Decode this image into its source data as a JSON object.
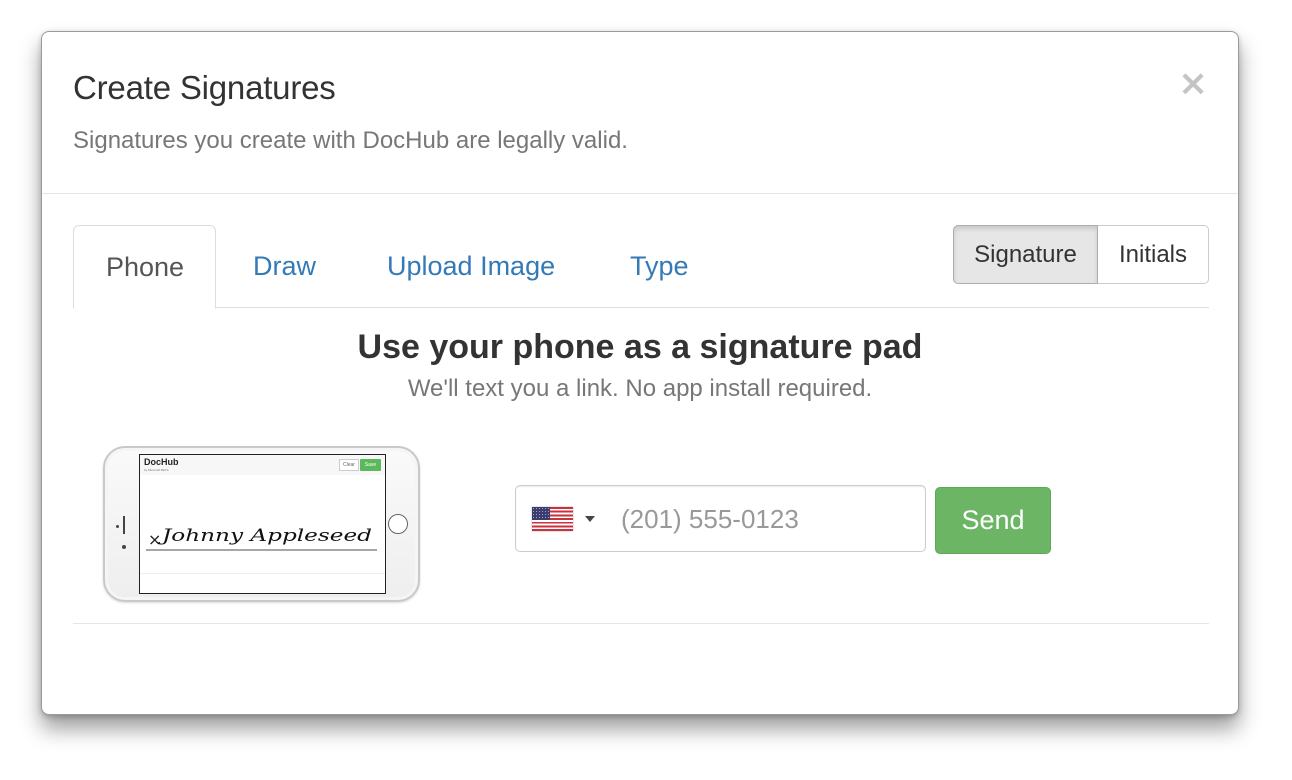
{
  "modal": {
    "title": "Create Signatures",
    "subtitle": "Signatures you create with DocHub are legally valid.",
    "close_icon": "×"
  },
  "tabs": [
    {
      "label": "Phone",
      "active": true
    },
    {
      "label": "Draw",
      "active": false
    },
    {
      "label": "Upload Image",
      "active": false
    },
    {
      "label": "Type",
      "active": false
    }
  ],
  "mode_toggle": {
    "options": [
      {
        "label": "Signature",
        "selected": true
      },
      {
        "label": "Initials",
        "selected": false
      }
    ]
  },
  "phone_panel": {
    "heading": "Use your phone as a signature pad",
    "subheading": "We'll text you a link. No app install required.",
    "illustration": {
      "logo": "DocHub",
      "logo_sub": "by Microsoft    BETA",
      "clear_label": "Clear",
      "save_label": "Save",
      "signature_text": "Johnny Appleseed",
      "sign_mark": "×"
    },
    "country": {
      "selected": "US",
      "flag_icon": "us-flag-icon"
    },
    "phone_input": {
      "value": "",
      "placeholder": "(201) 555-0123"
    },
    "send_label": "Send"
  },
  "colors": {
    "link": "#337ab7",
    "send_button": "#6cb565",
    "close_icon": "#c4c4c4",
    "active_toggle": "#e6e6e6"
  }
}
